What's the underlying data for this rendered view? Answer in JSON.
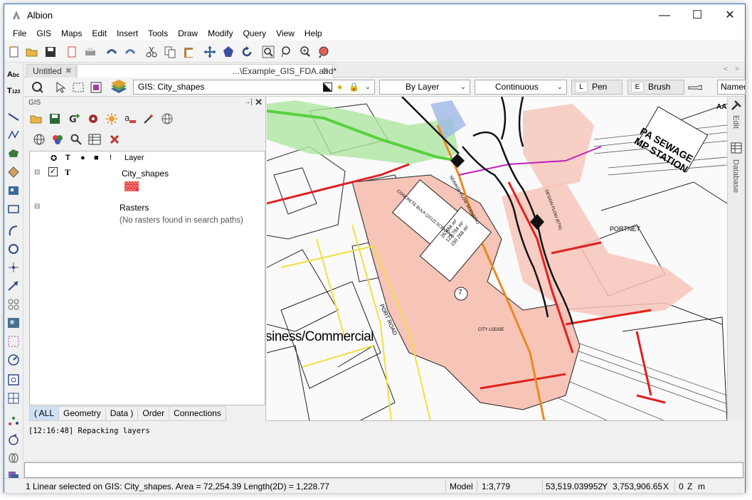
{
  "window": {
    "title": "Albion"
  },
  "menu": [
    "File",
    "GIS",
    "Maps",
    "Edit",
    "Insert",
    "Tools",
    "Draw",
    "Modify",
    "Query",
    "View",
    "Help"
  ],
  "tabs": [
    {
      "label": "Untitled",
      "active": false
    },
    {
      "label": "...\\Example_GIS_FDA.abd*",
      "active": true
    }
  ],
  "propbar": {
    "layer_combo": "GIS: City_shapes",
    "color_combo": "By Layer",
    "linetype_combo": "Continuous",
    "pen_key": "L",
    "pen_label": "Pen",
    "brush_key": "E",
    "brush_label": "Brush",
    "named_label": "Named"
  },
  "gis_panel": {
    "title": "GIS",
    "column_layer": "Layer",
    "layers": [
      {
        "name": "City_shapes",
        "flag": "T"
      }
    ],
    "rasters_label": "Rasters",
    "rasters_empty": "(No rasters found in search paths)",
    "bottom_tabs": [
      "( ALL",
      "Geometry",
      "Data )",
      "Order",
      "Connections"
    ]
  },
  "right_dock": {
    "edit_label": "Edit",
    "database_label": "Database"
  },
  "map_labels": {
    "zone": "siness/Commercial",
    "station_line1": "PA SEWAGE",
    "station_line2": "MP STATION",
    "portnet": "PORTNET",
    "port_road": "PORT ROAD",
    "city_lodge": "CITY LODGE",
    "marker": "7",
    "aa": "AA",
    "sewage_flow": "SEWAGE FLOW SCENARIO",
    "design_flow": "DESIGN FLOW (67%)",
    "cfw": "CONCRETE BULK (2012) SCENARIO",
    "box_line1": "26 484 m²",
    "box_line2": "123 784 m²",
    "box_line3": "150 268 m²"
  },
  "console": {
    "log": "[12:16:48] Repacking layers"
  },
  "status": {
    "message": "1 Linear selected on GIS: City_shapes.   Area = 72,254.39   Length(2D) = 1,228.77",
    "space": "Model",
    "scale": "1:3,779",
    "y_value": "53,519.039952",
    "y_label": "Y",
    "x_value": "3,753,906.65",
    "x_label": "X",
    "z_value": "0",
    "z_label": "Z",
    "unit": "m"
  }
}
